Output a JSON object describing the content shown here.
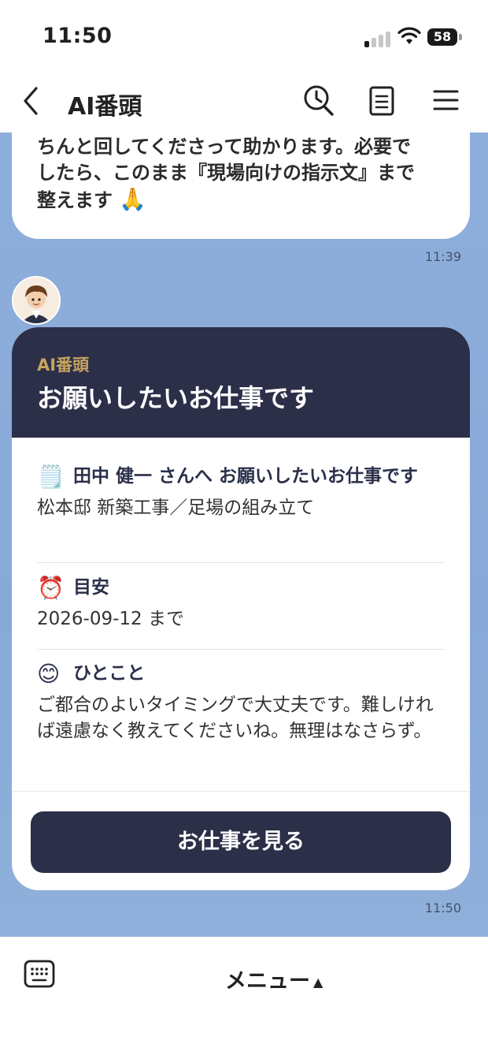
{
  "status_bar": {
    "time": "11:50",
    "battery": "58"
  },
  "header": {
    "title": "AI番頭",
    "icons": [
      "back-chevron-icon",
      "search-clock-icon",
      "notes-icon",
      "hamburger-menu-icon"
    ]
  },
  "messages": {
    "previous": {
      "text_lines": [
        "ちんと回してくださって助かります。必要で",
        "したら、このまま『現場向けの指示文』まで",
        "整えます"
      ],
      "emoji": "🙏",
      "time": "11:39"
    },
    "card": {
      "label": "AI番頭",
      "title": "お願いしたいお仕事です",
      "sections": [
        {
          "emoji": "🗒️",
          "heading": "田中 健一 さんへ お願いしたいお仕事です",
          "body": "松本邸 新築工事／足場の組み立て"
        },
        {
          "emoji": "⏰",
          "heading": "目安",
          "body": "2026-09-12 まで"
        },
        {
          "emoji": "😊",
          "heading": "ひとこと",
          "body": "ご都合のよいタイミングで大丈夫です。難しければ遠慮なく教えてくださいね。無理はなさらず。"
        }
      ],
      "button_label": "お仕事を見る",
      "time": "11:50"
    }
  },
  "bottom_bar": {
    "menu_label": "メニュー",
    "menu_arrow": "▲"
  },
  "colors": {
    "chat_background": "#8eaedb",
    "card_header": "#2b2f48",
    "card_label": "#c6a45f",
    "button": "#2b2f48"
  }
}
